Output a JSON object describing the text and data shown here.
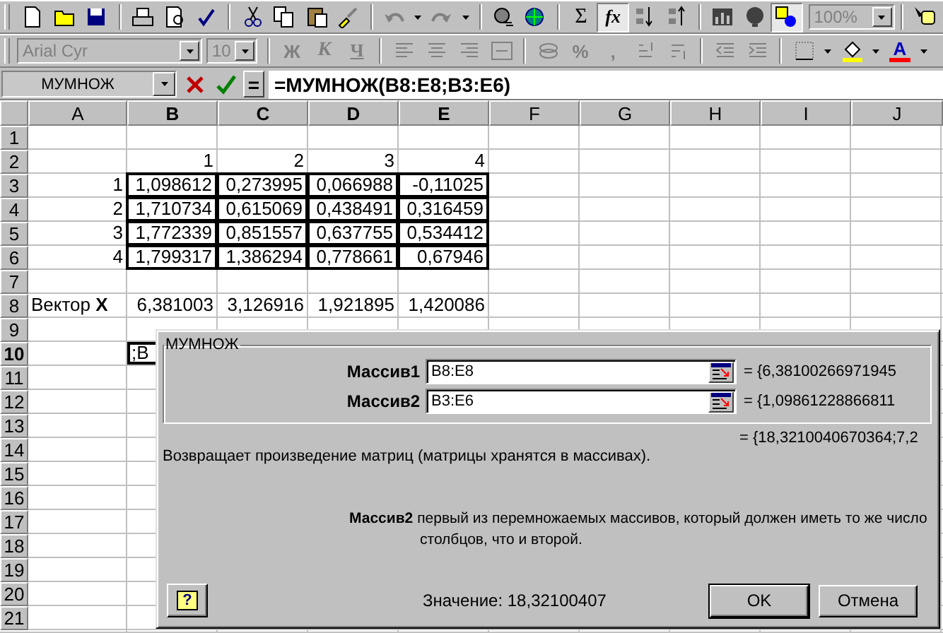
{
  "toolbar_standard": {
    "sum": "Σ",
    "function": {
      "label": "fx",
      "pressed": true
    },
    "zoom": "100%"
  },
  "toolbar_formatting": {
    "disabled": true,
    "font": "Arial Cyr",
    "size": "10",
    "bold": "Ж",
    "italic": "К",
    "underline": "Ч",
    "percent": "%",
    "comma": ",",
    "font_color": "A"
  },
  "formula_bar": {
    "name_box": "МУМНОЖ",
    "equals": "=",
    "formula": "=МУМНОЖ(B8:E8;B3:E6)"
  },
  "sheet": {
    "columns": [
      {
        "label": "A",
        "selected": false
      },
      {
        "label": "B",
        "selected": true
      },
      {
        "label": "C",
        "selected": true
      },
      {
        "label": "D",
        "selected": true
      },
      {
        "label": "E",
        "selected": true
      },
      {
        "label": "F",
        "selected": false
      },
      {
        "label": "G",
        "selected": false
      },
      {
        "label": "H",
        "selected": false
      },
      {
        "label": "I",
        "selected": false
      },
      {
        "label": "J",
        "selected": false
      }
    ],
    "rows": [
      {
        "number": "1",
        "selected": false
      },
      {
        "number": "2",
        "selected": false,
        "cells": {
          "B": {
            "text": "1",
            "kind": "number",
            "boxed": false,
            "active": false
          },
          "C": {
            "text": "2",
            "kind": "number",
            "boxed": false,
            "active": false
          },
          "D": {
            "text": "3",
            "kind": "number",
            "boxed": false,
            "active": false
          },
          "E": {
            "text": "4",
            "kind": "number",
            "boxed": false,
            "active": false
          }
        }
      },
      {
        "number": "3",
        "selected": false,
        "cells": {
          "A": {
            "text": "1",
            "kind": "number",
            "boxed": false,
            "active": false
          },
          "B": {
            "text": "1,098612",
            "kind": "number",
            "boxed": true,
            "active": false
          },
          "C": {
            "text": "0,273995",
            "kind": "number",
            "boxed": true,
            "active": false
          },
          "D": {
            "text": "0,066988",
            "kind": "number",
            "boxed": true,
            "active": false
          },
          "E": {
            "text": "-0,11025",
            "kind": "number",
            "boxed": true,
            "active": false
          }
        }
      },
      {
        "number": "4",
        "selected": false,
        "cells": {
          "A": {
            "text": "2",
            "kind": "number",
            "boxed": false,
            "active": false
          },
          "B": {
            "text": "1,710734",
            "kind": "number",
            "boxed": true,
            "active": false
          },
          "C": {
            "text": "0,615069",
            "kind": "number",
            "boxed": true,
            "active": false
          },
          "D": {
            "text": "0,438491",
            "kind": "number",
            "boxed": true,
            "active": false
          },
          "E": {
            "text": "0,316459",
            "kind": "number",
            "boxed": true,
            "active": false
          }
        }
      },
      {
        "number": "5",
        "selected": false,
        "cells": {
          "A": {
            "text": "3",
            "kind": "number",
            "boxed": false,
            "active": false
          },
          "B": {
            "text": "1,772339",
            "kind": "number",
            "boxed": true,
            "active": false
          },
          "C": {
            "text": "0,851557",
            "kind": "number",
            "boxed": true,
            "active": false
          },
          "D": {
            "text": "0,637755",
            "kind": "number",
            "boxed": true,
            "active": false
          },
          "E": {
            "text": "0,534412",
            "kind": "number",
            "boxed": true,
            "active": false
          }
        }
      },
      {
        "number": "6",
        "selected": false,
        "cells": {
          "A": {
            "text": "4",
            "kind": "number",
            "boxed": false,
            "active": false
          },
          "B": {
            "text": "1,799317",
            "kind": "number",
            "boxed": true,
            "active": false
          },
          "C": {
            "text": "1,386294",
            "kind": "number",
            "boxed": true,
            "active": false
          },
          "D": {
            "text": "0,778661",
            "kind": "number",
            "boxed": true,
            "active": false
          },
          "E": {
            "text": "0,67946",
            "kind": "number",
            "boxed": true,
            "active": false
          }
        }
      },
      {
        "number": "7",
        "selected": false
      },
      {
        "number": "8",
        "selected": false,
        "cells": {
          "A": {
            "text": "Вектор **X**",
            "kind": "text",
            "boxed": false,
            "active": false
          },
          "B": {
            "text": "6,381003",
            "kind": "number",
            "boxed": false,
            "active": false
          },
          "C": {
            "text": "3,126916",
            "kind": "number",
            "boxed": false,
            "active": false
          },
          "D": {
            "text": "1,921895",
            "kind": "number",
            "boxed": false,
            "active": false
          },
          "E": {
            "text": "1,420086",
            "kind": "number",
            "boxed": false,
            "active": false
          }
        }
      },
      {
        "number": "9",
        "selected": false
      },
      {
        "number": "10",
        "selected": true,
        "cells": {
          "B": {
            "text": ";B",
            "kind": "text",
            "boxed": false,
            "active": true
          }
        }
      },
      {
        "number": "11",
        "selected": false
      },
      {
        "number": "12",
        "selected": false
      },
      {
        "number": "13",
        "selected": false
      },
      {
        "number": "14",
        "selected": false
      },
      {
        "number": "15",
        "selected": false
      },
      {
        "number": "16",
        "selected": false
      },
      {
        "number": "17",
        "selected": false
      },
      {
        "number": "18",
        "selected": false
      },
      {
        "number": "19",
        "selected": false
      },
      {
        "number": "20",
        "selected": false
      },
      {
        "number": "21",
        "selected": false
      }
    ]
  },
  "dialog": {
    "title": "МУМНОЖ",
    "arguments": [
      {
        "label": "Массив1",
        "value": "B8:E8",
        "result": "= {6,38100266971945"
      },
      {
        "label": "Массив2",
        "value": "B3:E6",
        "result": "= {1,09861228866811"
      }
    ],
    "result": "= {18,3210040670364;7,2",
    "description": "Возвращает произведение матриц (матрицы хранятся в массивах).",
    "argument_help": "**Массив2** первый из перемножаемых массивов, который должен иметь то же число столбцов, что и второй.",
    "help_button": "?",
    "value": "Значение: 18,32100407",
    "buttons": [
      "OK",
      "Отмена"
    ]
  }
}
